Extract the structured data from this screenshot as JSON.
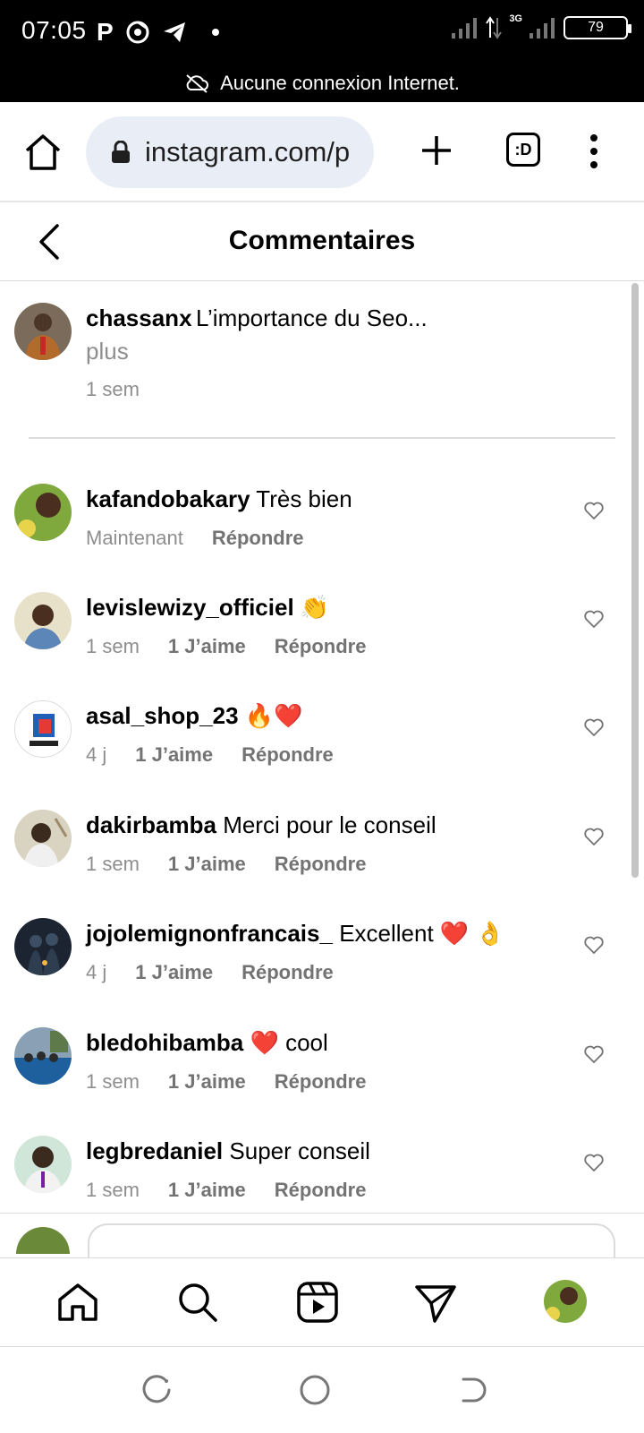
{
  "status_bar": {
    "time": "07:05",
    "app_icons": [
      "parking-icon",
      "chrome-icon",
      "telegram-icon"
    ],
    "network": "3G",
    "battery": "79"
  },
  "connection_banner": {
    "text": "Aucune connexion Internet."
  },
  "browser": {
    "url": "instagram.com/p",
    "tab_label": ":D"
  },
  "page": {
    "title": "Commentaires"
  },
  "caption": {
    "username": "chassanx",
    "text": "L’importance du Seo...",
    "more": "plus",
    "time": "1 sem"
  },
  "comments": [
    {
      "username": "kafandobakary",
      "text": "Très bien",
      "time": "Maintenant",
      "likes": "",
      "reply": "Répondre"
    },
    {
      "username": "levislewizy_officiel",
      "text": "👏",
      "time": "1 sem",
      "likes": "1 J’aime",
      "reply": "Répondre"
    },
    {
      "username": "asal_shop_23",
      "text": "🔥❤️",
      "time": "4 j",
      "likes": "1 J’aime",
      "reply": "Répondre"
    },
    {
      "username": "dakirbamba",
      "text": "Merci pour le conseil",
      "time": "1 sem",
      "likes": "1 J’aime",
      "reply": "Répondre"
    },
    {
      "username": "jojolemignonfrancais_",
      "text": "Excellent ❤️ 👌",
      "time": "4 j",
      "likes": "1 J’aime",
      "reply": "Répondre"
    },
    {
      "username": "bledohibamba",
      "text": "❤️ cool",
      "time": "1 sem",
      "likes": "1 J’aime",
      "reply": "Répondre"
    },
    {
      "username": "legbredaniel",
      "text": "Super conseil",
      "time": "1 sem",
      "likes": "1 J’aime",
      "reply": "Répondre"
    }
  ],
  "bottom_nav": [
    "home-icon",
    "search-icon",
    "reels-icon",
    "direct-icon",
    "profile-avatar"
  ],
  "colors": {
    "status_bar_bg": "#000000",
    "url_pill_bg": "#e9eef6",
    "muted_text": "#8e8e8e",
    "divider": "#dbdbdb"
  }
}
